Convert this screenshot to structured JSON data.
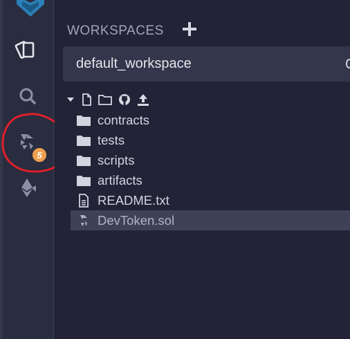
{
  "rail": {
    "badge_count": "5",
    "buttons": [
      "file-explorer",
      "search",
      "solidity-compiler",
      "deploy-run"
    ]
  },
  "workspaces": {
    "title": "WORKSPACES",
    "add_icon": "plus-icon",
    "selected_workspace": "default_workspace"
  },
  "toolbar": {
    "icons": [
      "caret-down-icon",
      "new-file-icon",
      "new-folder-icon",
      "github-icon",
      "upload-icon"
    ]
  },
  "tree": [
    {
      "type": "folder",
      "label": "contracts"
    },
    {
      "type": "folder",
      "label": "tests"
    },
    {
      "type": "folder",
      "label": "scripts"
    },
    {
      "type": "folder",
      "label": "artifacts"
    },
    {
      "type": "file",
      "label": "README.txt"
    },
    {
      "type": "solidity",
      "label": "DevToken.sol",
      "selected": true
    }
  ],
  "colors": {
    "background": "#222336",
    "rail": "#2a2c3f",
    "text": "#d3d4e0",
    "badge": "#f0a050",
    "annotation": "#e0202a"
  }
}
